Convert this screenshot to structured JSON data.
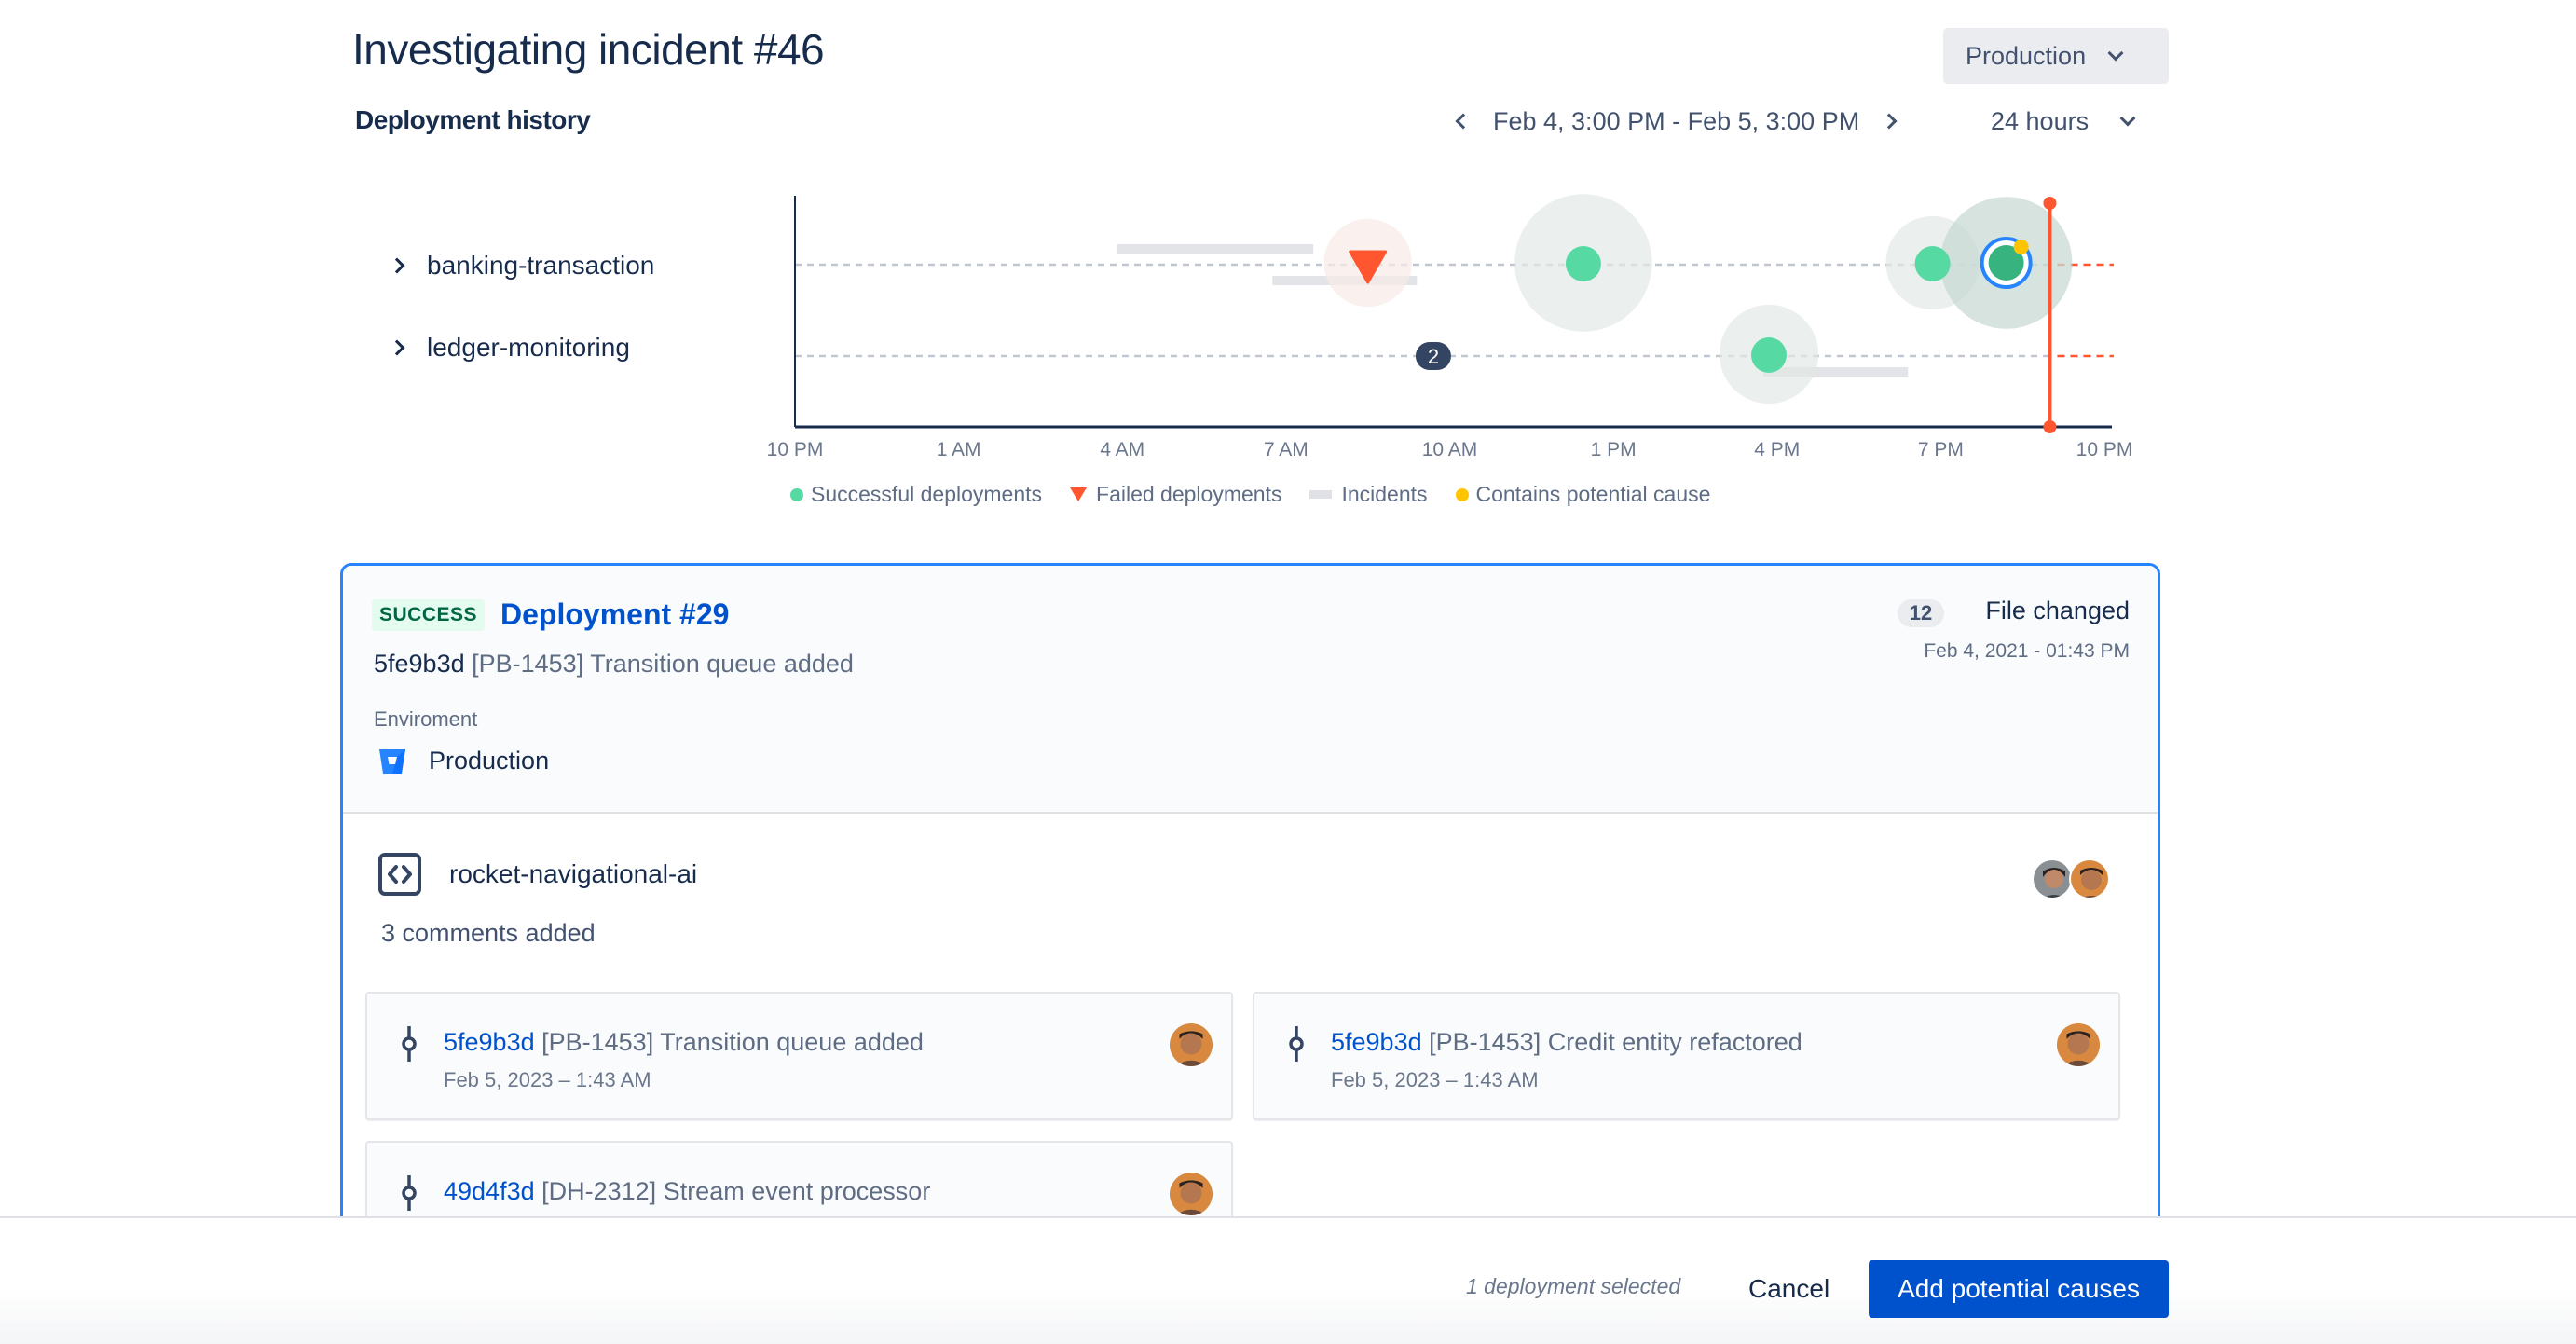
{
  "header": {
    "title": "Investigating incident #46",
    "section_title": "Deployment history",
    "environment_dropdown": {
      "selected": "Production",
      "icon": "chevron-down-icon"
    },
    "date_range": {
      "label": "Feb 4, 3:00 PM - Feb 5, 3:00 PM",
      "prev_icon": "chevron-left-icon",
      "next_icon": "chevron-right-icon"
    },
    "range_dropdown": {
      "selected": "24 hours",
      "icon": "chevron-down-icon"
    }
  },
  "rows": [
    {
      "label": "banking-transaction",
      "icon": "chevron-right-icon"
    },
    {
      "label": "ledger-monitoring",
      "icon": "chevron-right-icon"
    }
  ],
  "chart_data": {
    "type": "scatter",
    "title": "Deployment history",
    "x_unit": "hours since 10 PM (Feb 4)",
    "xlim": [
      0,
      24
    ],
    "tick_labels": [
      "10 PM",
      "1 AM",
      "4 AM",
      "7 AM",
      "10 AM",
      "1 PM",
      "4 PM",
      "7 PM",
      "10 PM"
    ],
    "tick_values": [
      0,
      3,
      6,
      9,
      12,
      15,
      18,
      21,
      24
    ],
    "categories": [
      "banking-transaction",
      "ledger-monitoring"
    ],
    "grid": "dotted row lines",
    "incident_marker": {
      "x": 23.0,
      "label": "incident time",
      "color": "#ff5630"
    },
    "deployments": [
      {
        "row": "banking-transaction",
        "x": 10.5,
        "status": "failed",
        "halo": 0.8
      },
      {
        "row": "banking-transaction",
        "x": 14.45,
        "status": "success",
        "halo": 1.25
      },
      {
        "row": "banking-transaction",
        "x": 20.85,
        "status": "success",
        "halo": 0.85
      },
      {
        "row": "banking-transaction",
        "x": 22.2,
        "status": "success",
        "halo": 1.2,
        "selected": true,
        "potential_cause": true
      },
      {
        "row": "ledger-monitoring",
        "x": 17.85,
        "status": "success",
        "halo": 0.9
      }
    ],
    "clusters": [
      {
        "row": "ledger-monitoring",
        "x": 11.7,
        "count": "2"
      }
    ],
    "incidents": [
      {
        "row": "banking-transaction",
        "start": 5.9,
        "end": 9.5,
        "lane": "upper"
      },
      {
        "row": "banking-transaction",
        "start": 8.75,
        "end": 11.4,
        "lane": "lower"
      },
      {
        "row": "ledger-monitoring",
        "start": 17.75,
        "end": 20.4,
        "lane": "lower"
      }
    ],
    "legend": [
      {
        "label": "Successful deployments",
        "symbol": "dot",
        "color": "#57d9a3"
      },
      {
        "label": "Failed deployments",
        "symbol": "triangle",
        "color": "#ff5630"
      },
      {
        "label": "Incidents",
        "symbol": "bar",
        "color": "#dfe1e6"
      },
      {
        "label": "Contains potential cause",
        "symbol": "dot",
        "color": "#ffc400"
      }
    ],
    "legend_position": "bottom"
  },
  "deployment": {
    "status_badge": "SUCCESS",
    "title": "Deployment #29",
    "commit_hash": "5fe9b3d",
    "commit_message": "[PB-1453] Transition queue added",
    "environment_label": "Enviroment",
    "environment_value": "Production",
    "environment_icon": "bitbucket-icon",
    "files_count": "12",
    "files_label": "File changed",
    "date": "Feb 4, 2021 - 01:43 PM",
    "repo": {
      "name": "rocket-navigational-ai",
      "icon": "code-icon"
    },
    "comments": "3 comments added",
    "commits": [
      {
        "hash": "5fe9b3d",
        "message": "[PB-1453] Transition queue added",
        "date": "Feb 5, 2023 – 1:43 AM",
        "icon": "commit-icon"
      },
      {
        "hash": "5fe9b3d",
        "message": "[PB-1453] Credit entity refactored",
        "date": "Feb 5, 2023 – 1:43 AM",
        "icon": "commit-icon"
      },
      {
        "hash": "49d4f3d",
        "message": "[DH-2312] Stream event processor",
        "date": "",
        "icon": "commit-icon"
      }
    ]
  },
  "footer": {
    "selected_count": "1 deployment selected",
    "cancel_label": "Cancel",
    "primary_label": "Add potential causes"
  },
  "colors": {
    "primary": "#0052cc",
    "selection_border": "#2684ff",
    "success": "#57d9a3",
    "success_selected": "#36b37e",
    "failed": "#ff5630",
    "potential_cause": "#ffc400",
    "text": "#172b4d"
  }
}
